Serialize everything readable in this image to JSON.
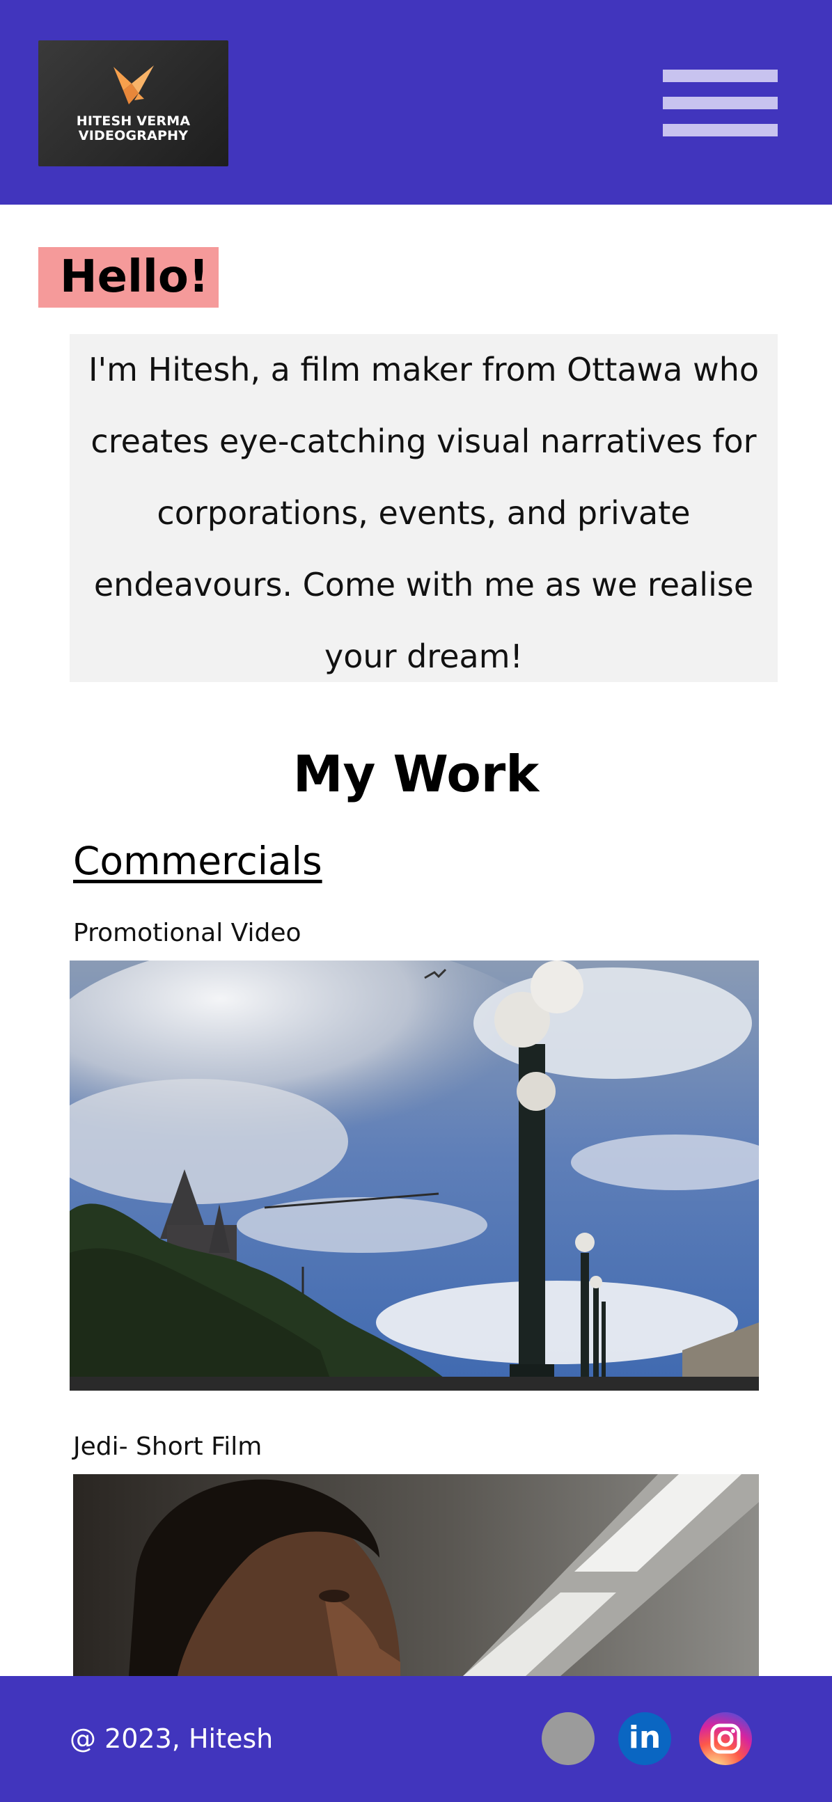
{
  "header": {
    "logo_line1": "HITESH VERMA",
    "logo_line2": "VIDEOGRAPHY",
    "menu_icon": "hamburger-menu-icon"
  },
  "intro": {
    "greeting": "Hello!",
    "lines": [
      "I'm Hitesh, a film maker from Ottawa who",
      "creates eye-catching visual narratives for",
      "corporations, events, and private",
      "endeavours. Come with me as we realise",
      "your dream!"
    ]
  },
  "work": {
    "heading": "My Work",
    "category": "Commercials",
    "items": [
      {
        "title": "Promotional Video"
      },
      {
        "title": "Jedi- Short Film"
      }
    ]
  },
  "footer": {
    "copyright": "@ 2023, Hitesh",
    "social": [
      {
        "icon": "generic-social-icon",
        "color": "#9b9b9b"
      },
      {
        "icon": "linkedin-icon",
        "color": "#0a66c2",
        "glyph": "in"
      },
      {
        "icon": "instagram-icon",
        "color": "#d6249f"
      }
    ]
  },
  "colors": {
    "primary": "#4135bd",
    "hello_bg": "#f59a9a",
    "intro_bg": "#f2f2f2"
  }
}
